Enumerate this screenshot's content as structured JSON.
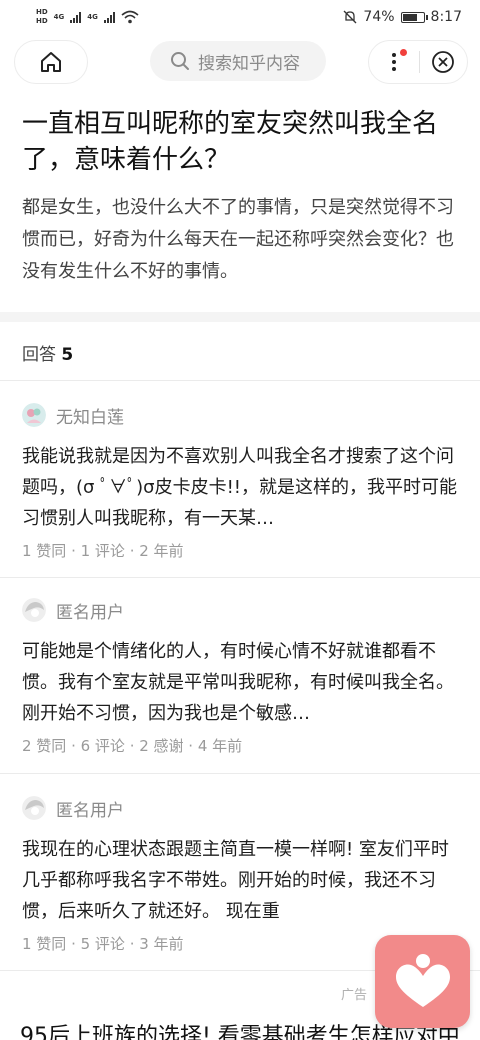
{
  "status_bar": {
    "hd_top": "HD",
    "hd_bottom": "HD",
    "net1": "4G",
    "net2": "4G",
    "battery_percent": "74%",
    "battery_level": 0.74,
    "time": "8:17"
  },
  "nav": {
    "search_placeholder": "搜索知乎内容"
  },
  "question": {
    "title": "一直相互叫昵称的室友突然叫我全名了，意味着什么？",
    "description": "都是女生，也没什么大不了的事情，只是突然觉得不习惯而已，好奇为什么每天在一起还称呼突然会变化？也没有发生什么不好的事情。"
  },
  "answers_header": {
    "label": "回答",
    "count": "5"
  },
  "answers": [
    {
      "author": "无知白莲",
      "excerpt": "我能说我就是因为不喜欢别人叫我全名才搜索了这个问题吗，(σ ﾟ∀ﾟ)σ皮卡皮卡!!，就是这样的，我平时可能习惯别人叫我昵称，有一天某…",
      "meta": "1 赞同 · 1 评论 · 2 年前"
    },
    {
      "author": "匿名用户",
      "excerpt": "可能她是个情绪化的人，有时候心情不好就谁都看不惯。我有个室友就是平常叫我昵称，有时候叫我全名。刚开始不习惯，因为我也是个敏感…",
      "meta": "2 赞同 · 6 评论 · 2 感谢 · 4 年前"
    },
    {
      "author": "匿名用户",
      "excerpt": "我现在的心理状态跟题主简直一模一样啊! 室友们平时几乎都称呼我名字不带姓。刚开始的时候，我还不习惯，后来听久了就还好。 现在重",
      "meta": "1 赞同 · 5 评论 · 3 年前"
    }
  ],
  "ad": {
    "tag": "广告",
    "title": "95后上班族的选择! 看零基础考生怎样应对中"
  },
  "colors": {
    "accent_red": "#f1403c",
    "like_button": "#f28a8a"
  },
  "icons": [
    "home-icon",
    "search-icon",
    "more-icon",
    "close-icon",
    "heart-icon"
  ]
}
